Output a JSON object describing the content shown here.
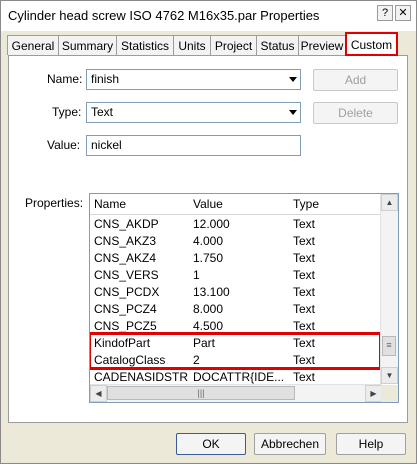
{
  "window": {
    "title": "Cylinder head screw ISO 4762 M16x35.par Properties",
    "help_glyph": "?",
    "close_glyph": "✕"
  },
  "tabs": [
    {
      "label": "General"
    },
    {
      "label": "Summary"
    },
    {
      "label": "Statistics"
    },
    {
      "label": "Units"
    },
    {
      "label": "Project"
    },
    {
      "label": "Status"
    },
    {
      "label": "Preview"
    },
    {
      "label": "Custom",
      "active": true
    }
  ],
  "form": {
    "name_label": "Name:",
    "name_value": "finish",
    "type_label": "Type:",
    "type_value": "Text",
    "value_label": "Value:",
    "value_value": "nickel",
    "add_label": "Add",
    "delete_label": "Delete",
    "properties_label": "Properties:"
  },
  "properties": {
    "columns": [
      "Name",
      "Value",
      "Type"
    ],
    "rows": [
      {
        "name": "CNS_AKDP",
        "value": "12.000",
        "type": "Text"
      },
      {
        "name": "CNS_AKZ3",
        "value": "4.000",
        "type": "Text"
      },
      {
        "name": "CNS_AKZ4",
        "value": "1.750",
        "type": "Text"
      },
      {
        "name": "CNS_VERS",
        "value": "1",
        "type": "Text"
      },
      {
        "name": "CNS_PCDX",
        "value": "13.100",
        "type": "Text"
      },
      {
        "name": "CNS_PCZ4",
        "value": "8.000",
        "type": "Text"
      },
      {
        "name": "CNS_PCZ5",
        "value": "4.500",
        "type": "Text"
      },
      {
        "name": "KindofPart",
        "value": "Part",
        "type": "Text"
      },
      {
        "name": "CatalogClass",
        "value": "2",
        "type": "Text"
      },
      {
        "name": "CADENASIDSTR",
        "value": "DOCATTR{IDE...",
        "type": "Text"
      }
    ]
  },
  "footer": {
    "ok_label": "OK",
    "cancel_label": "Abbrechen",
    "help_label": "Help"
  },
  "colors": {
    "highlight": "#e00000",
    "face": "#ece9d8"
  }
}
